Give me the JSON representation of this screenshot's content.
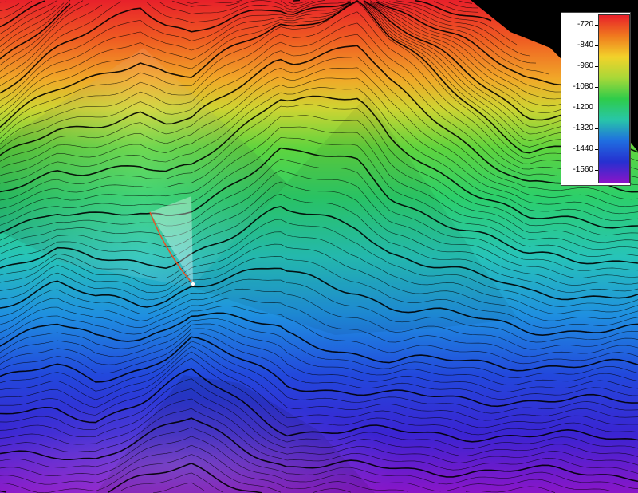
{
  "legend": {
    "ticks": [
      "-720",
      "-840",
      "-960",
      "-1080",
      "-1200",
      "-1320",
      "-1440",
      "-1560"
    ],
    "tick_values": [
      -720,
      -840,
      -960,
      -1080,
      -1200,
      -1320,
      -1440,
      -1560
    ],
    "range": [
      -1640,
      -660
    ],
    "colors": [
      "#e8202a",
      "#f07a1e",
      "#f2d22a",
      "#a8d838",
      "#2ecc4a",
      "#28c6a8",
      "#1f6ee0",
      "#2630d0",
      "#8a14c8"
    ]
  },
  "terrain": {
    "background_color": "#000000",
    "contour_color": "#000000"
  }
}
